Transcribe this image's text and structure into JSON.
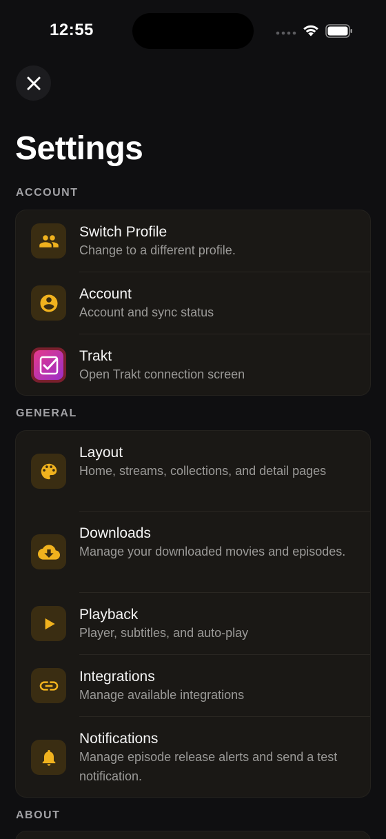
{
  "status_bar": {
    "time": "12:55"
  },
  "header": {
    "title": "Settings"
  },
  "sections": {
    "account": {
      "label": "ACCOUNT",
      "items": [
        {
          "title": "Switch Profile",
          "subtitle": "Change to a different profile.",
          "icon": "people-icon"
        },
        {
          "title": "Account",
          "subtitle": "Account and sync status",
          "icon": "account-circle-icon"
        },
        {
          "title": "Trakt",
          "subtitle": "Open Trakt connection screen",
          "icon": "trakt-logo-icon"
        }
      ]
    },
    "general": {
      "label": "GENERAL",
      "items": [
        {
          "title": "Layout",
          "subtitle": "Home, streams, collections, and detail pages",
          "icon": "palette-icon"
        },
        {
          "title": "Downloads",
          "subtitle": "Manage your downloaded movies and episodes.",
          "icon": "cloud-download-icon"
        },
        {
          "title": "Playback",
          "subtitle": "Player, subtitles, and auto-play",
          "icon": "play-icon"
        },
        {
          "title": "Integrations",
          "subtitle": "Manage available integrations",
          "icon": "link-icon"
        },
        {
          "title": "Notifications",
          "subtitle": "Manage episode release alerts and send a test notification.",
          "icon": "bell-icon"
        }
      ]
    },
    "about": {
      "label": "ABOUT"
    }
  },
  "colors": {
    "background": "#0f0f11",
    "card": "#1a1815",
    "accent": "#f0b21e",
    "icon_bg": "#3a2d12"
  }
}
